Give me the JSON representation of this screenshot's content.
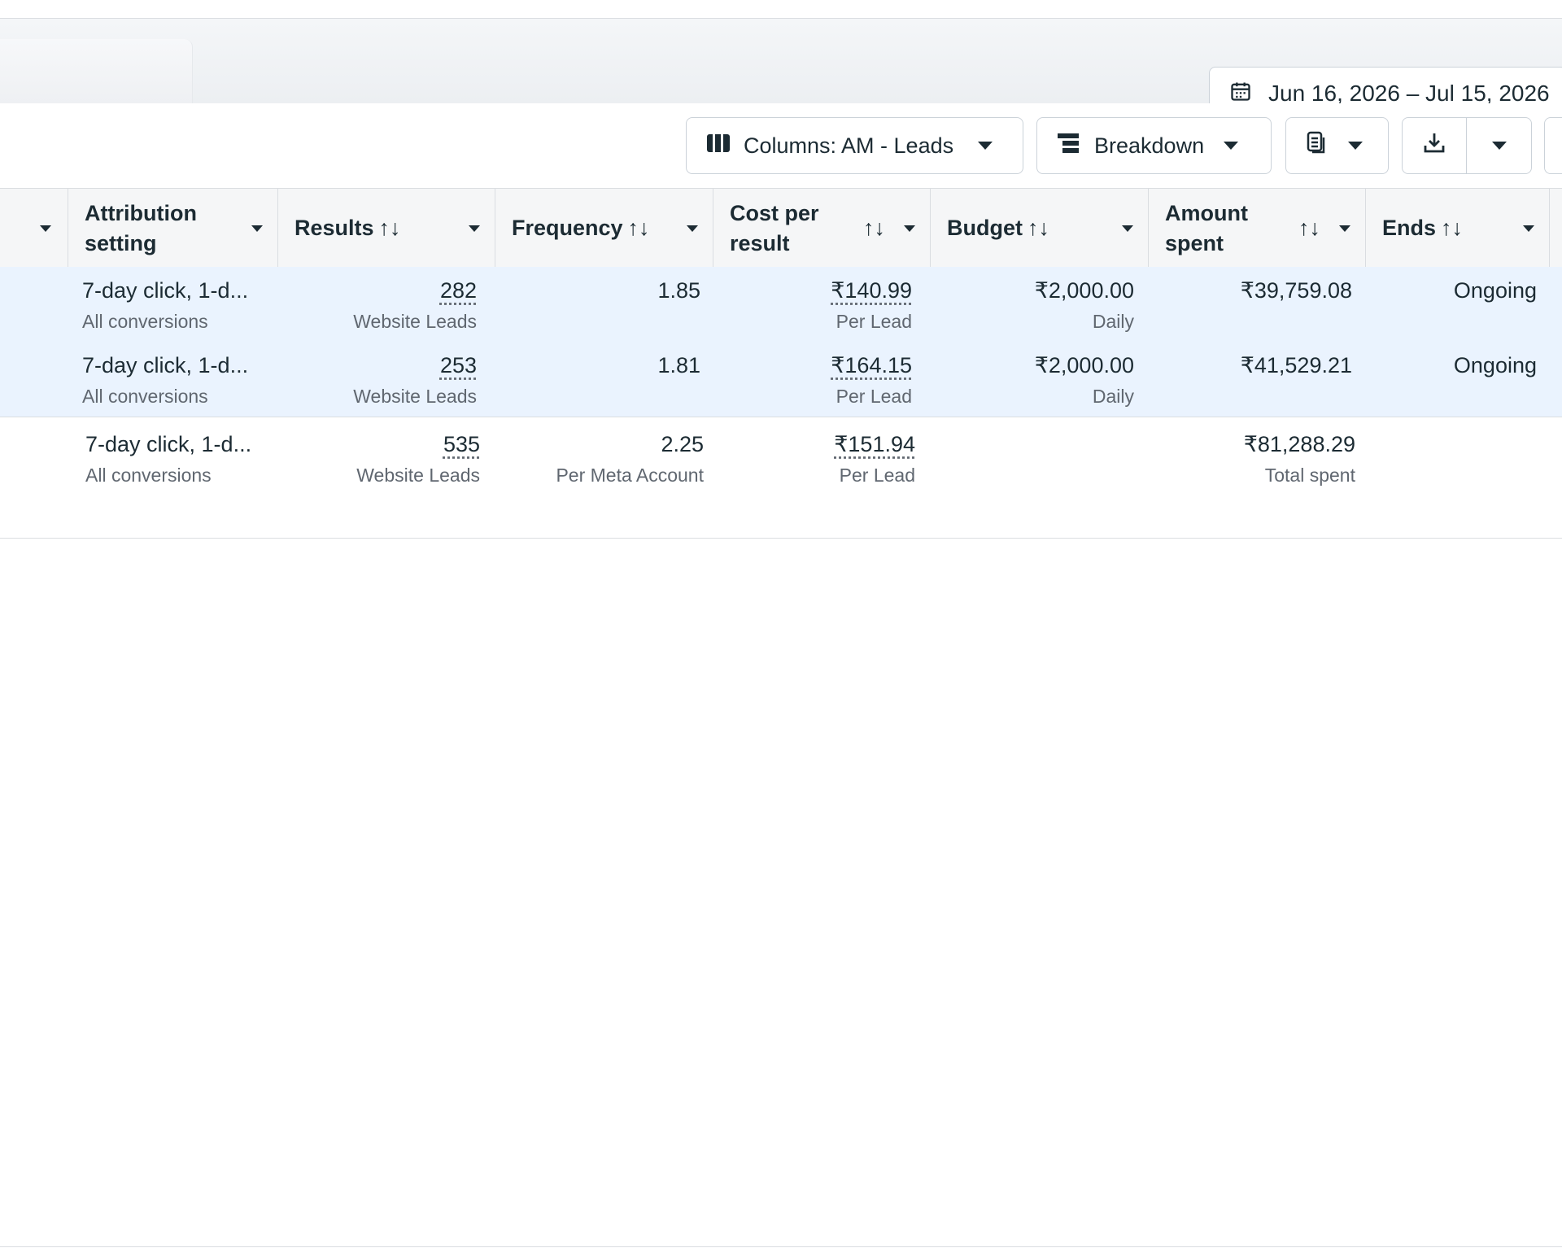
{
  "date_range": {
    "label": "Jun 16, 2026 – Jul 15, 2026",
    "icon": "calendar-icon"
  },
  "toolbar": {
    "columns_label": "Columns: AM - Leads",
    "columns_icon": "columns-icon",
    "breakdown_label": "Breakdown",
    "breakdown_icon": "breakdown-icon",
    "reports_icon": "reports-icon",
    "export_icon": "download-icon"
  },
  "table": {
    "headers": {
      "attribution": "Attribution setting",
      "results": "Results",
      "frequency": "Frequency",
      "cost": "Cost per result",
      "budget": "Budget",
      "amount": "Amount spent",
      "ends": "Ends",
      "sort_glyph": "↑↓"
    },
    "rows": [
      {
        "attribution": "7-day click, 1-d...",
        "attribution_sub": "All conversions",
        "results": "282",
        "results_sub": "Website Leads",
        "frequency": "1.85",
        "cost": "₹140.99",
        "cost_sub": "Per Lead",
        "budget": "₹2,000.00",
        "budget_sub": "Daily",
        "amount": "₹39,759.08",
        "ends": "Ongoing"
      },
      {
        "attribution": "7-day click, 1-d...",
        "attribution_sub": "All conversions",
        "results": "253",
        "results_sub": "Website Leads",
        "frequency": "1.81",
        "cost": "₹164.15",
        "cost_sub": "Per Lead",
        "budget": "₹2,000.00",
        "budget_sub": "Daily",
        "amount": "₹41,529.21",
        "ends": "Ongoing"
      }
    ],
    "totals": {
      "attribution": "7-day click, 1-d...",
      "attribution_sub": "All conversions",
      "results": "535",
      "results_sub": "Website Leads",
      "frequency": "2.25",
      "frequency_sub": "Per Meta Account",
      "cost": "₹151.94",
      "cost_sub": "Per Lead",
      "amount": "₹81,288.29",
      "amount_sub": "Total spent"
    }
  }
}
